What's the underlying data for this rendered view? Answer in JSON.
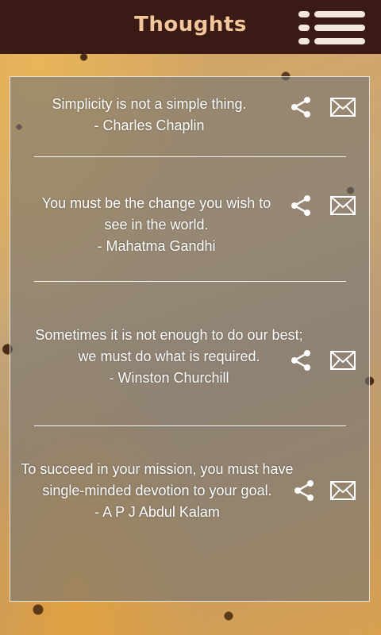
{
  "header": {
    "title": "Thoughts",
    "menu_icon": "menu-icon"
  },
  "quotes": [
    {
      "line1": "Simplicity is not a simple thing.",
      "line2": "- Charles Chaplin",
      "share_icon": "share-icon",
      "mail_icon": "mail-icon"
    },
    {
      "line1": "You must be the change you wish to",
      "line2": "see in the world.",
      "line3": "- Mahatma Gandhi",
      "share_icon": "share-icon",
      "mail_icon": "mail-icon"
    },
    {
      "line1": "Sometimes it is not enough to do our best;",
      "line2": "we must do what is required.",
      "line3": "- Winston Churchill",
      "share_icon": "share-icon",
      "mail_icon": "mail-icon"
    },
    {
      "line1": "To succeed in your mission, you must have",
      "line2": "single-minded devotion to your goal.",
      "line3": "- A P J Abdul Kalam",
      "share_icon": "share-icon",
      "mail_icon": "mail-icon"
    }
  ],
  "colors": {
    "header_bg": "#3a1a14",
    "title": "#f3c79b"
  }
}
